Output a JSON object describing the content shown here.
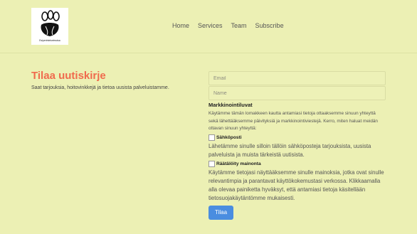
{
  "header": {
    "logo_text": "Esiperinteisetmoisa",
    "nav": [
      "Home",
      "Services",
      "Team",
      "Subscribe"
    ]
  },
  "left": {
    "title": "Tilaa uutiskirje",
    "subtitle": "Saat tarjouksia, hoitovinkkejä ja tietoa uusista palveluistamme."
  },
  "form": {
    "email_placeholder": "Email",
    "name_placeholder": "Name",
    "marketing_heading": "Markkinointiluvat",
    "marketing_text": "Käytämme tämän lomakkeen kautta antamiasi tietoja ottaaksemme sinuun yhteyttä sekä lähettääksemme päivityksiä ja markkinointiviestejä. Kerro, miten haluat meidän ottavan sinuun yhteyttä:",
    "checkbox_email_label": "Sähköposti",
    "email_consent_text": "Lähetämme sinulle silloin tällöin sähköposteja tarjouksista, uusista palveluista ja muista tärkeistä uutisista.",
    "checkbox_ads_label": "Räätälöity mainonta",
    "ads_consent_text": "Käytämme tietojasi näyttääksemme sinulle mainoksia, jotka ovat sinulle relevantimpia ja parantavat käyttökokemustasi verkossa. Klikkaamalla alla olevaa painiketta hyväksyt, että antamiasi tietoja käsitellään tietosuojakäytäntömme mukaisesti.",
    "submit_label": "Tilaa"
  },
  "colors": {
    "background": "#ecf0b4",
    "title": "#f06a4d",
    "button": "#4a8de0"
  }
}
